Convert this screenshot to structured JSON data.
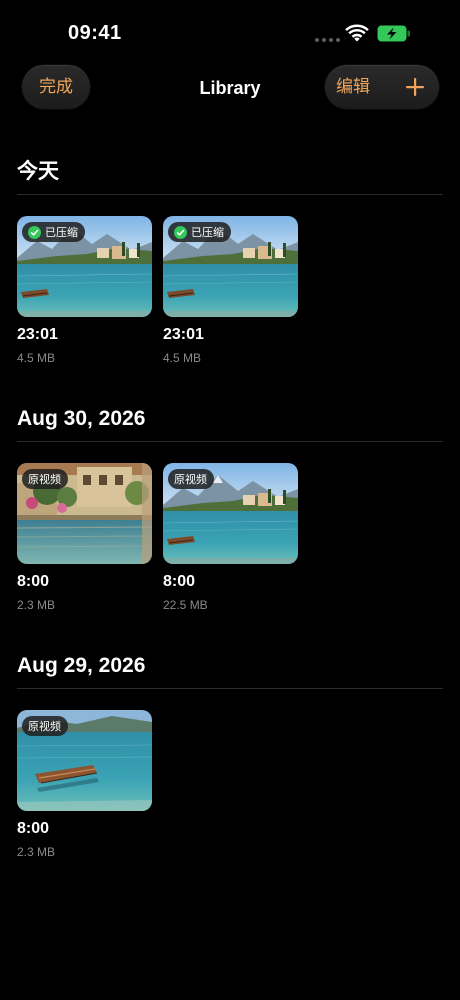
{
  "status_bar": {
    "time": "09:41"
  },
  "nav": {
    "title": "Library",
    "done_label": "完成",
    "edit_label": "编辑",
    "accent_color": "#f0a45a"
  },
  "sections": [
    {
      "title": "今天",
      "items": [
        {
          "badge": "已压缩",
          "compressed": true,
          "time": "23:01",
          "size": "4.5 MB",
          "scene": "lake-village"
        },
        {
          "badge": "已压缩",
          "compressed": true,
          "time": "23:01",
          "size": "4.5 MB",
          "scene": "lake-village"
        }
      ]
    },
    {
      "title": "Aug 30, 2026",
      "items": [
        {
          "badge": "原视频",
          "compressed": false,
          "time": "8:00",
          "size": "2.3 MB",
          "scene": "villa-waterfront"
        },
        {
          "badge": "原视频",
          "compressed": false,
          "time": "8:00",
          "size": "22.5 MB",
          "scene": "lake-village"
        }
      ]
    },
    {
      "title": "Aug 29, 2026",
      "items": [
        {
          "badge": "原视频",
          "compressed": false,
          "time": "8:00",
          "size": "2.3 MB",
          "scene": "boat-lake"
        }
      ]
    }
  ]
}
